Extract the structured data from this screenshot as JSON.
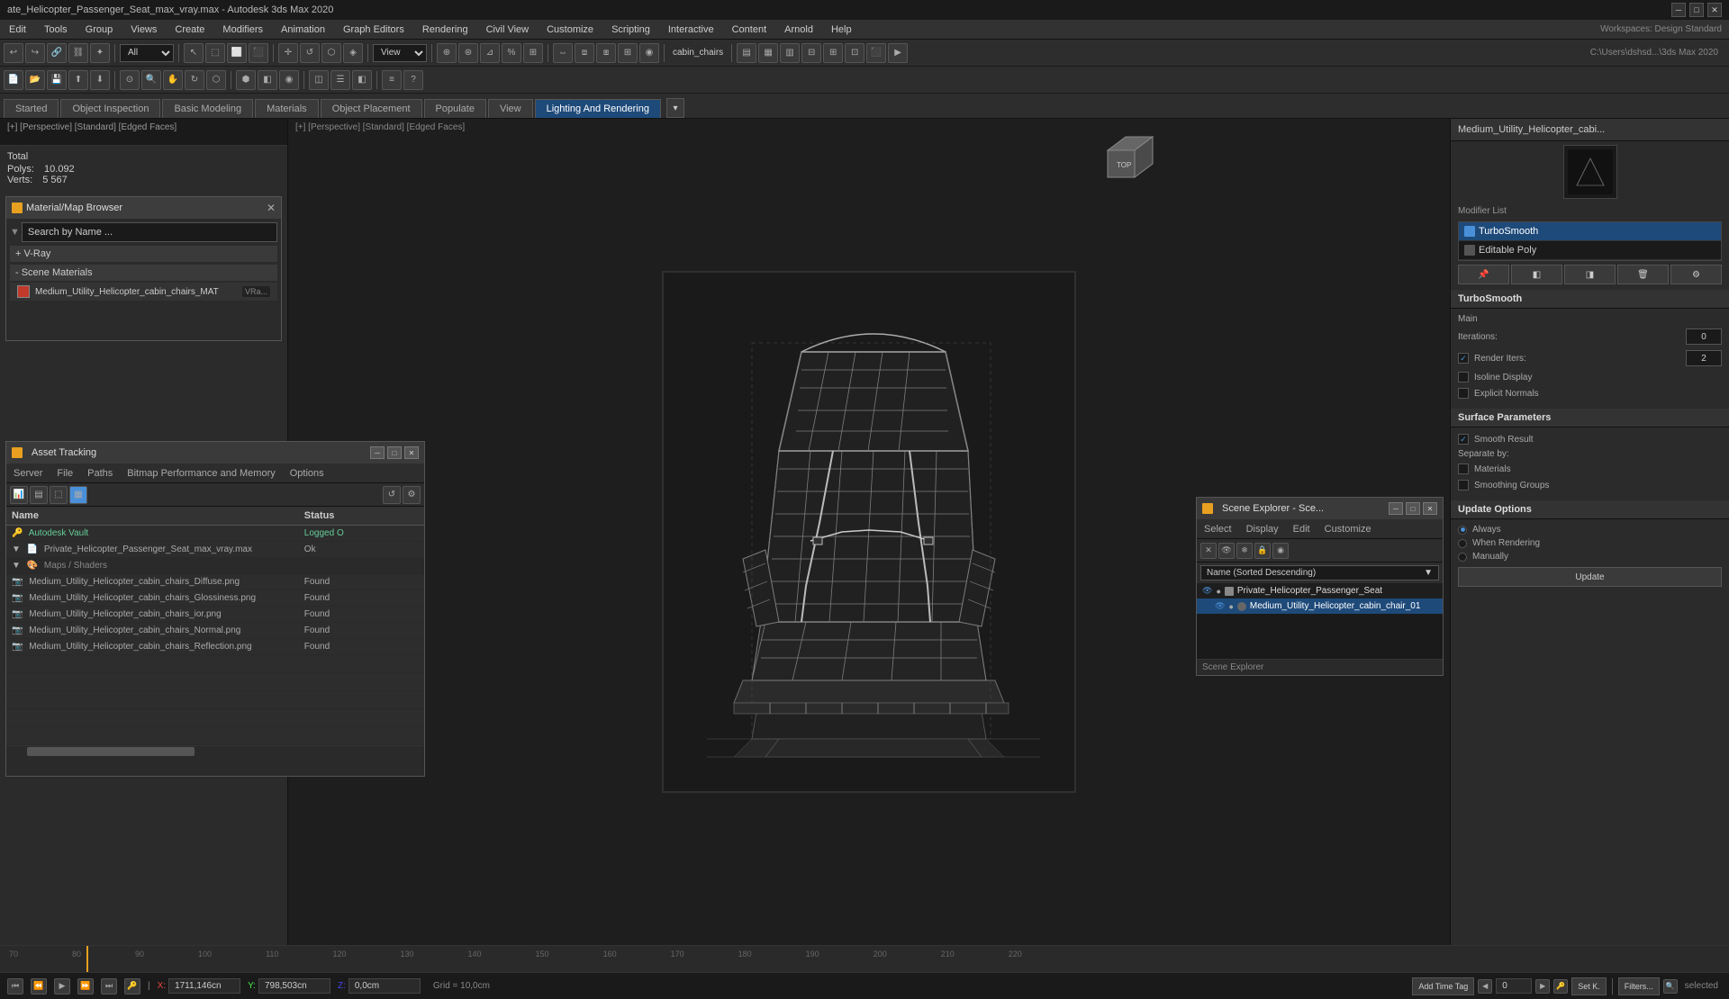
{
  "titleBar": {
    "title": "ate_Helicopter_Passenger_Seat_max_vray.max - Autodesk 3ds Max 2020",
    "minimize": "─",
    "maximize": "□",
    "close": "✕"
  },
  "menuBar": {
    "items": [
      "Edit",
      "Tools",
      "Group",
      "Views",
      "Create",
      "Modifiers",
      "Animation",
      "Graph Editors",
      "Rendering",
      "Civil View",
      "Customize",
      "Scripting",
      "Interactive",
      "Content",
      "Arnold",
      "Help"
    ]
  },
  "toolbar1": {
    "dropdown1": "All",
    "modeLabel": "View"
  },
  "tabBar": {
    "tabs": [
      "Started",
      "Object Inspection",
      "Basic Modeling",
      "Materials",
      "Object Placement",
      "Populate",
      "View",
      "Lighting And Rendering"
    ],
    "activeTab": "Lighting And Rendering"
  },
  "viewportInfo": {
    "label": "[+] [Perspective] [Standard] [Edged Faces]",
    "total": "Total",
    "polys": "10.092",
    "verts": "5 567",
    "polysLabel": "Polys:",
    "vertsLabel": "Verts:"
  },
  "materialBrowser": {
    "title": "Material/Map Browser",
    "searchPlaceholder": "Search by Name ...",
    "vraySection": "+ V-Ray",
    "sceneMaterialsSection": "- Scene Materials",
    "material": {
      "name": "Medium_Utility_Helicopter_cabin_chairs_MAT",
      "type": "VRa..."
    }
  },
  "assetTracking": {
    "title": "Asset Tracking",
    "menuItems": [
      "Server",
      "File",
      "Paths",
      "Bitmap Performance and Memory",
      "Options"
    ],
    "columns": [
      "Name",
      "Status"
    ],
    "items": [
      {
        "name": "Autodesk Vault",
        "status": "Logged O",
        "level": 0,
        "type": "vault"
      },
      {
        "name": "Private_Helicopter_Passenger_Seat_max_vray.max",
        "status": "Ok",
        "level": 1,
        "type": "file"
      },
      {
        "name": "Maps / Shaders",
        "status": "",
        "level": 2,
        "type": "group"
      },
      {
        "name": "Medium_Utility_Helicopter_cabin_chairs_Diffuse.png",
        "status": "Found",
        "level": 3,
        "type": "map"
      },
      {
        "name": "Medium_Utility_Helicopter_cabin_chairs_Glossiness.png",
        "status": "Found",
        "level": 3,
        "type": "map"
      },
      {
        "name": "Medium_Utility_Helicopter_cabin_chairs_ior.png",
        "status": "Found",
        "level": 3,
        "type": "map"
      },
      {
        "name": "Medium_Utility_Helicopter_cabin_chairs_Normal.png",
        "status": "Found",
        "level": 3,
        "type": "map"
      },
      {
        "name": "Medium_Utility_Helicopter_cabin_chairs_Reflection.png",
        "status": "Found",
        "level": 3,
        "type": "map"
      }
    ]
  },
  "rightPanel": {
    "objectName": "Medium_Utility_Helicopter_cabi...",
    "modifierListLabel": "Modifier List",
    "modifiers": [
      {
        "name": "TurboSmooth",
        "active": true
      },
      {
        "name": "Editable Poly",
        "active": false
      }
    ],
    "turboSmooth": {
      "label": "TurboSmooth",
      "mainLabel": "Main",
      "iterationsLabel": "Iterations:",
      "iterationsValue": "0",
      "renderItersLabel": "Render Iters:",
      "renderItersValue": "2",
      "isolineDisplay": "Isoline Display",
      "explicitNormals": "Explicit Normals"
    },
    "surfaceParams": {
      "label": "Surface Parameters",
      "smoothResult": "Smooth Result",
      "separateByLabel": "Separate by:",
      "materials": "Materials",
      "smoothingGroups": "Smoothing Groups"
    },
    "updateOptions": {
      "label": "Update Options",
      "always": "Always",
      "whenRendering": "When Rendering",
      "manually": "Manually",
      "updateBtn": "Update"
    }
  },
  "sceneExplorer": {
    "title": "Scene Explorer - Sce...",
    "menuItems": [
      "Select",
      "Display",
      "Edit",
      "Customize"
    ],
    "dropdown": "Name (Sorted Descending)",
    "items": [
      {
        "name": "Private_Helicopter_Passenger_Seat",
        "level": 0,
        "expanded": true
      },
      {
        "name": "Medium_Utility_Helicopter_cabin_chair_01",
        "level": 1,
        "active": true
      }
    ],
    "statusBar": "Scene Explorer"
  },
  "bottomBar": {
    "xLabel": "X:",
    "xValue": "1711,146cn",
    "yLabel": "Y:",
    "yValue": "798,503cn",
    "zLabel": "Z:",
    "zValue": "0,0cm",
    "grid": "Grid = 10,0cm",
    "addTimeTag": "Add Time Tag",
    "frameValue": "0",
    "setK": "Set K.",
    "filters": "Filters...",
    "selected": "selected"
  },
  "workspaces": {
    "label": "Workspaces:",
    "value": "Design Standard",
    "pathLabel": "C:\\Users\\dshsd...\\3ds Max 2020"
  },
  "icons": {
    "close": "✕",
    "minimize": "─",
    "maximize": "□",
    "expand": "▶",
    "collapse": "▼",
    "eye": "👁",
    "file": "📄",
    "folder": "📁",
    "lock": "🔒",
    "camera": "📷",
    "light": "💡"
  }
}
